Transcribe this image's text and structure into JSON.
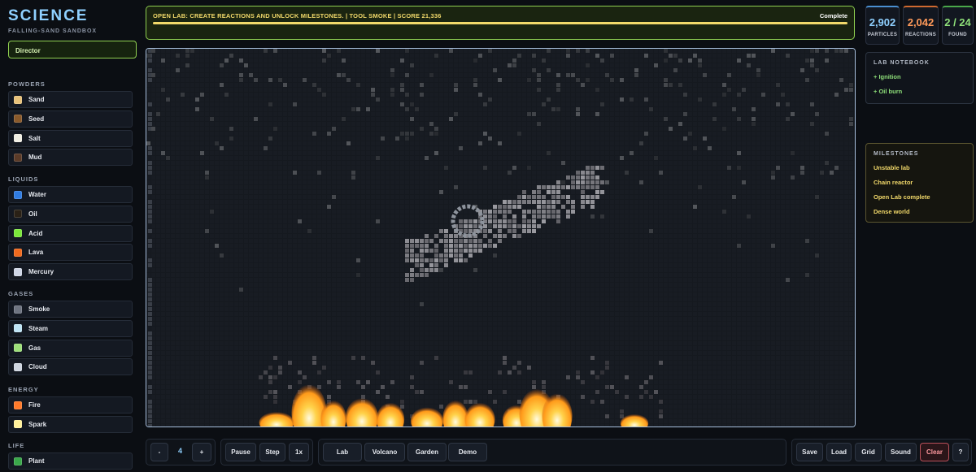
{
  "app": {
    "title": "SCIENCE",
    "subtitle": "FALLING-SAND SANDBOX",
    "mode": "Director"
  },
  "materials": [
    {
      "group": "POWDERS",
      "items": [
        {
          "label": "Sand",
          "color": "#e8c27a"
        },
        {
          "label": "Seed",
          "color": "#8a5a2b"
        },
        {
          "label": "Salt",
          "color": "#f1efe4"
        },
        {
          "label": "Mud",
          "color": "#5b3b28"
        }
      ]
    },
    {
      "group": "LIQUIDS",
      "items": [
        {
          "label": "Water",
          "color": "#2f7be0"
        },
        {
          "label": "Oil",
          "color": "#2a2116"
        },
        {
          "label": "Acid",
          "color": "#7be83a"
        },
        {
          "label": "Lava",
          "color": "#f06a1e"
        },
        {
          "label": "Mercury",
          "color": "#cfd6e6"
        }
      ]
    },
    {
      "group": "GASES",
      "items": [
        {
          "label": "Smoke",
          "color": "#6e7480"
        },
        {
          "label": "Steam",
          "color": "#bfe4f5"
        },
        {
          "label": "Gas",
          "color": "#9ee07a"
        },
        {
          "label": "Cloud",
          "color": "#cfd6e0"
        }
      ]
    },
    {
      "group": "ENERGY",
      "items": [
        {
          "label": "Fire",
          "color": "#ff7a2a"
        },
        {
          "label": "Spark",
          "color": "#fff09a"
        }
      ]
    },
    {
      "group": "LIFE",
      "items": [
        {
          "label": "Plant",
          "color": "#3aa84a"
        }
      ]
    }
  ],
  "banner": {
    "text": "OPEN LAB: CREATE REACTIONS AND UNLOCK MILESTONES. | TOOL SMOKE | SCORE 21,336",
    "status": "Complete",
    "progress": 1.0
  },
  "stats": [
    {
      "value": "2,902",
      "label": "PARTICLES",
      "color": "#8fd0ff"
    },
    {
      "value": "2,042",
      "label": "REACTIONS",
      "color": "#ff9a5a"
    },
    {
      "value": "2 / 24",
      "label": "FOUND",
      "color": "#8fe07a"
    }
  ],
  "notebook": {
    "title": "LAB NOTEBOOK",
    "items": [
      "+ Ignition",
      "+ Oil burn"
    ]
  },
  "milestones": {
    "title": "MILESTONES",
    "items": [
      "Unstable lab",
      "Chain reactor",
      "Open Lab complete",
      "Dense world"
    ]
  },
  "toolbar": {
    "minus": "-",
    "brush_size": "4",
    "plus": "+",
    "pause": "Pause",
    "step": "Step",
    "speed": "1x",
    "scene_lab": "Lab",
    "scene_volcano": "Volcano",
    "scene_garden": "Garden",
    "scene_demo": "Demo",
    "save": "Save",
    "load": "Load",
    "grid": "Grid",
    "sound": "Sound",
    "clear": "Clear",
    "help": "?"
  },
  "colors": {
    "accent_green": "#8fd050",
    "accent_blue": "#8fd0ff",
    "gold": "#f2d96a",
    "fire": "#ffb020"
  }
}
